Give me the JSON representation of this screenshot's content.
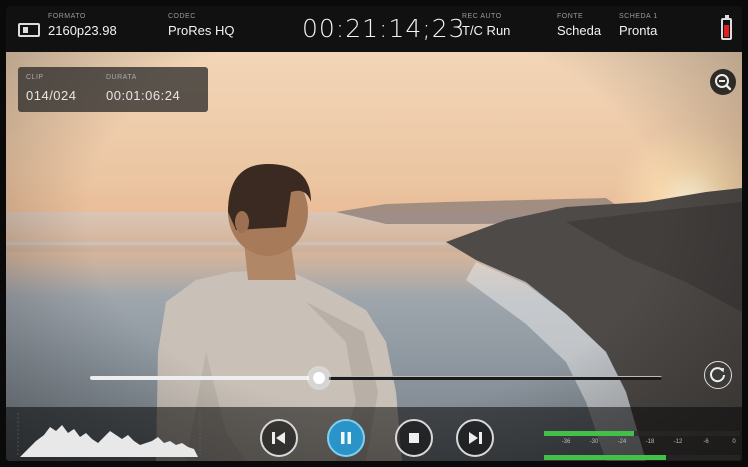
{
  "topbar": {
    "format": {
      "label": "FORMATO",
      "value": "2160p23.98"
    },
    "codec": {
      "label": "CODEC",
      "value": "ProRes HQ"
    },
    "timecode": "00:21:14;23",
    "rec": {
      "label": "REC AUTO",
      "value": "T/C Run"
    },
    "source": {
      "label": "FONTE",
      "value": "Scheda"
    },
    "card": {
      "label": "SCHEDA 1",
      "value": "Pronta"
    },
    "battery_color": "#e02020"
  },
  "clip_info": {
    "clip_label": "CLIP",
    "clip_value": "014/024",
    "duration_label": "DURATA",
    "duration_value": "00:01:06:24"
  },
  "playback": {
    "progress": 0.4,
    "state": "paused",
    "controls": [
      "previous-icon",
      "pause-icon",
      "stop-icon",
      "next-icon"
    ],
    "accent": "#2a93c8"
  },
  "audio_meters": {
    "scale": [
      "-36",
      "-30",
      "-24",
      "-18",
      "-12",
      "-6",
      "0"
    ],
    "ch1_level": 0.46,
    "ch2_level": 0.62,
    "meter_color": "#44c049"
  },
  "icons": {
    "zoom": "zoom-icon",
    "loop": "loop-icon",
    "monitor": "monitor-icon",
    "battery": "battery-icon"
  }
}
